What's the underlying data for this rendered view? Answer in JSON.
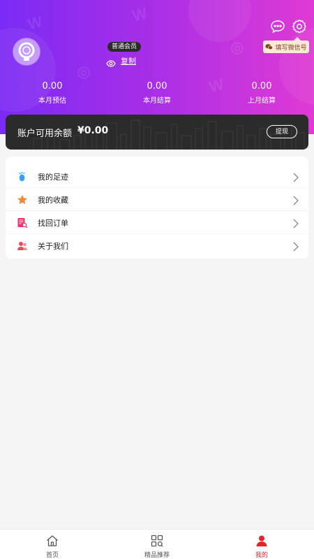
{
  "header": {
    "member_level": "普通会员",
    "copy_label": "复制",
    "wechat_tag": "填写微信号",
    "icons": [
      "message-icon",
      "settings-icon"
    ]
  },
  "stats": [
    {
      "value": "0.00",
      "label": "本月预估"
    },
    {
      "value": "0.00",
      "label": "本月结算"
    },
    {
      "value": "0.00",
      "label": "上月结算"
    }
  ],
  "balance": {
    "label": "账户可用余额",
    "value": "¥0.00",
    "withdraw_label": "提现"
  },
  "menu": [
    {
      "label": "我的足迹",
      "icon": "footprint-icon",
      "color": "#3aa0f0"
    },
    {
      "label": "我的收藏",
      "icon": "star-icon",
      "color": "#f08a3a"
    },
    {
      "label": "找回订单",
      "icon": "order-search-icon",
      "color": "#e33a6a"
    },
    {
      "label": "关于我们",
      "icon": "about-us-icon",
      "color": "#f04a5a"
    }
  ],
  "tabbar": [
    {
      "label": "首页",
      "icon": "home-icon",
      "active": false
    },
    {
      "label": "精品推荐",
      "icon": "grid-icon",
      "active": false
    },
    {
      "label": "我的",
      "icon": "user-icon",
      "active": true
    }
  ],
  "colors": {
    "accent": "#e0282b",
    "gradient_start": "#7b2bf5",
    "gradient_end": "#e03ad4"
  }
}
